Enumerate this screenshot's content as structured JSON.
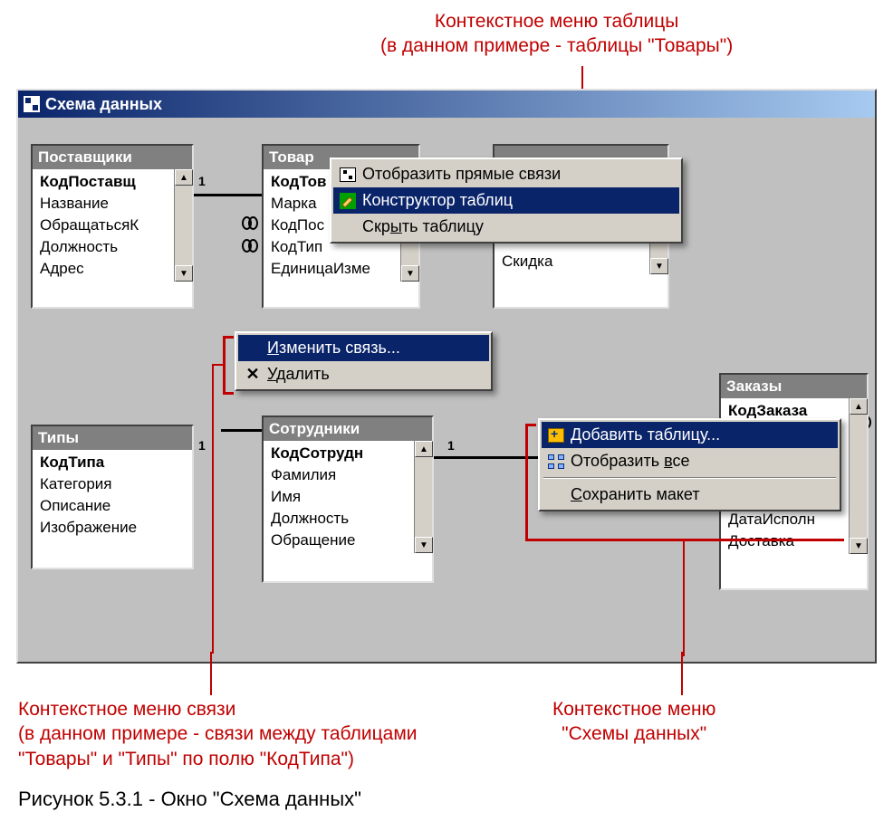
{
  "annotations": {
    "top": "Контекстное меню таблицы\n(в данном примере - таблицы \"Товары\")",
    "bottom_left": "Контекстное меню связи\n(в данном примере - связи между таблицами\n\"Товары\" и \"Типы\" по полю \"КодТипа\")",
    "bottom_right": "Контекстное меню\n\"Схемы данных\""
  },
  "caption": "Рисунок 5.3.1 - Окно \"Схема данных\"",
  "window": {
    "title": "Схема данных"
  },
  "tables": {
    "suppliers": {
      "title": "Поставщики",
      "fields": [
        "КодПоставщ",
        "Название",
        "ОбращатьсяК",
        "Должность",
        "Адрес"
      ]
    },
    "products": {
      "title": "Товар",
      "fields": [
        "КодТов",
        "Марка",
        "КодПос",
        "КодТип",
        "ЕдиницаИзме"
      ]
    },
    "types": {
      "title": "Типы",
      "fields": [
        "КодТипа",
        "Категория",
        "Описание",
        "Изображение"
      ]
    },
    "employees": {
      "title": "Сотрудники",
      "fields": [
        "КодСотрудн",
        "Фамилия",
        "Имя",
        "Должность",
        "Обращение"
      ]
    },
    "orders": {
      "title": "Заказы",
      "fields": [
        "КодЗаказа",
        "",
        "",
        "",
        "",
        "",
        "Доставка"
      ]
    },
    "discount": {
      "field": "Скидка"
    }
  },
  "menus": {
    "table": {
      "items": [
        {
          "label": "Отобразить прямые связи",
          "icon": "rel-icon",
          "sel": false
        },
        {
          "label": "Конструктор таблиц",
          "icon": "wrench-icon",
          "sel": true
        },
        {
          "label": "Скрыть таблицу",
          "icon": "",
          "sel": false
        }
      ]
    },
    "link": {
      "items": [
        {
          "label": "Изменить связь...",
          "icon": "",
          "sel": true
        },
        {
          "label": "Удалить",
          "icon": "del-icon",
          "sel": false
        }
      ]
    },
    "schema": {
      "items": [
        {
          "label": "Добавить таблицу...",
          "icon": "add-icon",
          "sel": true
        },
        {
          "label": "Отобразить все",
          "icon": "grid-icon",
          "sel": false
        },
        {
          "sep": true
        },
        {
          "label": "Сохранить макет",
          "icon": "",
          "sel": false
        }
      ]
    }
  },
  "rel_labels": {
    "one": "1"
  }
}
